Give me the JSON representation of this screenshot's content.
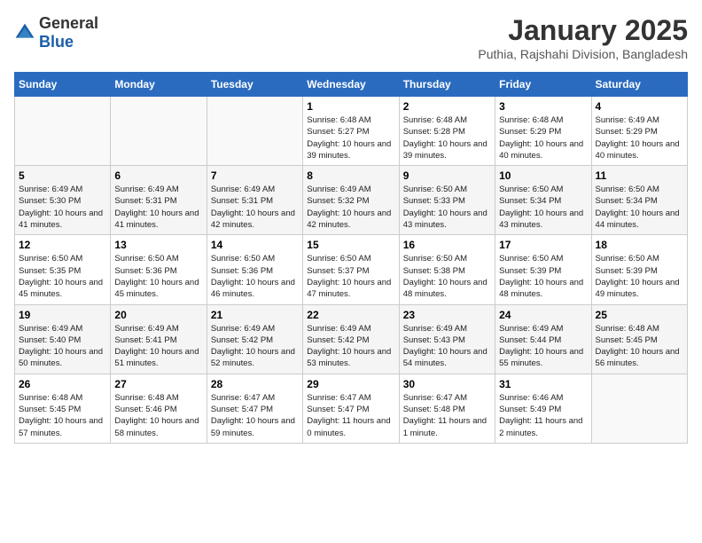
{
  "logo": {
    "general": "General",
    "blue": "Blue"
  },
  "title": "January 2025",
  "location": "Puthia, Rajshahi Division, Bangladesh",
  "days_of_week": [
    "Sunday",
    "Monday",
    "Tuesday",
    "Wednesday",
    "Thursday",
    "Friday",
    "Saturday"
  ],
  "weeks": [
    [
      {
        "num": "",
        "info": ""
      },
      {
        "num": "",
        "info": ""
      },
      {
        "num": "",
        "info": ""
      },
      {
        "num": "1",
        "info": "Sunrise: 6:48 AM\nSunset: 5:27 PM\nDaylight: 10 hours and 39 minutes."
      },
      {
        "num": "2",
        "info": "Sunrise: 6:48 AM\nSunset: 5:28 PM\nDaylight: 10 hours and 39 minutes."
      },
      {
        "num": "3",
        "info": "Sunrise: 6:48 AM\nSunset: 5:29 PM\nDaylight: 10 hours and 40 minutes."
      },
      {
        "num": "4",
        "info": "Sunrise: 6:49 AM\nSunset: 5:29 PM\nDaylight: 10 hours and 40 minutes."
      }
    ],
    [
      {
        "num": "5",
        "info": "Sunrise: 6:49 AM\nSunset: 5:30 PM\nDaylight: 10 hours and 41 minutes."
      },
      {
        "num": "6",
        "info": "Sunrise: 6:49 AM\nSunset: 5:31 PM\nDaylight: 10 hours and 41 minutes."
      },
      {
        "num": "7",
        "info": "Sunrise: 6:49 AM\nSunset: 5:31 PM\nDaylight: 10 hours and 42 minutes."
      },
      {
        "num": "8",
        "info": "Sunrise: 6:49 AM\nSunset: 5:32 PM\nDaylight: 10 hours and 42 minutes."
      },
      {
        "num": "9",
        "info": "Sunrise: 6:50 AM\nSunset: 5:33 PM\nDaylight: 10 hours and 43 minutes."
      },
      {
        "num": "10",
        "info": "Sunrise: 6:50 AM\nSunset: 5:34 PM\nDaylight: 10 hours and 43 minutes."
      },
      {
        "num": "11",
        "info": "Sunrise: 6:50 AM\nSunset: 5:34 PM\nDaylight: 10 hours and 44 minutes."
      }
    ],
    [
      {
        "num": "12",
        "info": "Sunrise: 6:50 AM\nSunset: 5:35 PM\nDaylight: 10 hours and 45 minutes."
      },
      {
        "num": "13",
        "info": "Sunrise: 6:50 AM\nSunset: 5:36 PM\nDaylight: 10 hours and 45 minutes."
      },
      {
        "num": "14",
        "info": "Sunrise: 6:50 AM\nSunset: 5:36 PM\nDaylight: 10 hours and 46 minutes."
      },
      {
        "num": "15",
        "info": "Sunrise: 6:50 AM\nSunset: 5:37 PM\nDaylight: 10 hours and 47 minutes."
      },
      {
        "num": "16",
        "info": "Sunrise: 6:50 AM\nSunset: 5:38 PM\nDaylight: 10 hours and 48 minutes."
      },
      {
        "num": "17",
        "info": "Sunrise: 6:50 AM\nSunset: 5:39 PM\nDaylight: 10 hours and 48 minutes."
      },
      {
        "num": "18",
        "info": "Sunrise: 6:50 AM\nSunset: 5:39 PM\nDaylight: 10 hours and 49 minutes."
      }
    ],
    [
      {
        "num": "19",
        "info": "Sunrise: 6:49 AM\nSunset: 5:40 PM\nDaylight: 10 hours and 50 minutes."
      },
      {
        "num": "20",
        "info": "Sunrise: 6:49 AM\nSunset: 5:41 PM\nDaylight: 10 hours and 51 minutes."
      },
      {
        "num": "21",
        "info": "Sunrise: 6:49 AM\nSunset: 5:42 PM\nDaylight: 10 hours and 52 minutes."
      },
      {
        "num": "22",
        "info": "Sunrise: 6:49 AM\nSunset: 5:42 PM\nDaylight: 10 hours and 53 minutes."
      },
      {
        "num": "23",
        "info": "Sunrise: 6:49 AM\nSunset: 5:43 PM\nDaylight: 10 hours and 54 minutes."
      },
      {
        "num": "24",
        "info": "Sunrise: 6:49 AM\nSunset: 5:44 PM\nDaylight: 10 hours and 55 minutes."
      },
      {
        "num": "25",
        "info": "Sunrise: 6:48 AM\nSunset: 5:45 PM\nDaylight: 10 hours and 56 minutes."
      }
    ],
    [
      {
        "num": "26",
        "info": "Sunrise: 6:48 AM\nSunset: 5:45 PM\nDaylight: 10 hours and 57 minutes."
      },
      {
        "num": "27",
        "info": "Sunrise: 6:48 AM\nSunset: 5:46 PM\nDaylight: 10 hours and 58 minutes."
      },
      {
        "num": "28",
        "info": "Sunrise: 6:47 AM\nSunset: 5:47 PM\nDaylight: 10 hours and 59 minutes."
      },
      {
        "num": "29",
        "info": "Sunrise: 6:47 AM\nSunset: 5:47 PM\nDaylight: 11 hours and 0 minutes."
      },
      {
        "num": "30",
        "info": "Sunrise: 6:47 AM\nSunset: 5:48 PM\nDaylight: 11 hours and 1 minute."
      },
      {
        "num": "31",
        "info": "Sunrise: 6:46 AM\nSunset: 5:49 PM\nDaylight: 11 hours and 2 minutes."
      },
      {
        "num": "",
        "info": ""
      }
    ]
  ]
}
